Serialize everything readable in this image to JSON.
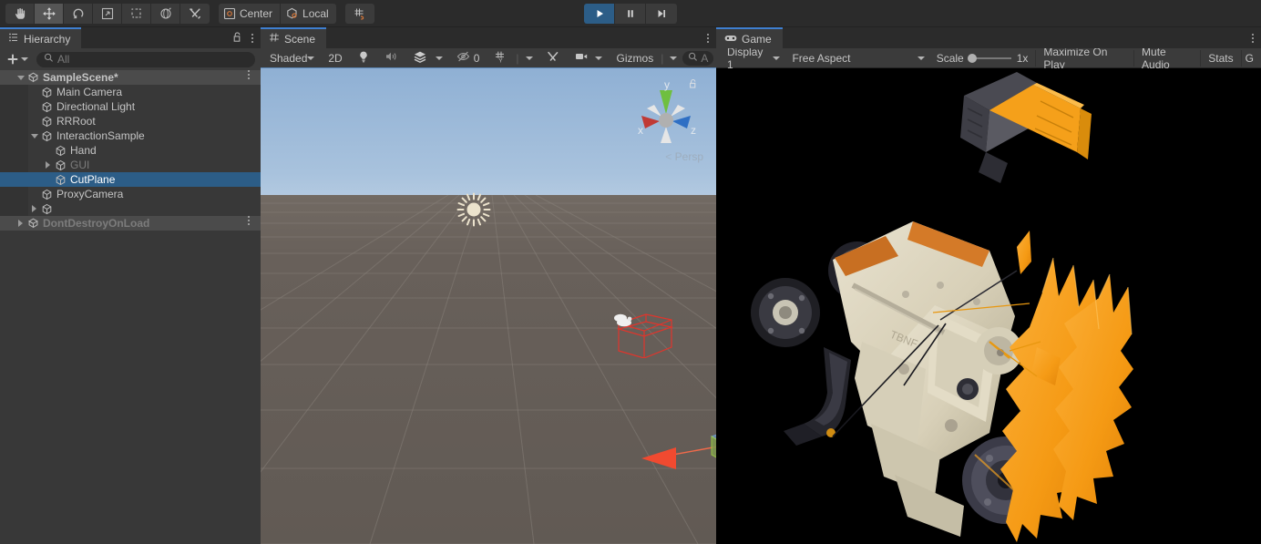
{
  "toolbar": {
    "tools": [
      {
        "name": "hand-tool",
        "icon": "hand-icon",
        "active": false
      },
      {
        "name": "move-tool",
        "icon": "move-icon",
        "active": true
      },
      {
        "name": "rotate-tool",
        "icon": "rotate-icon",
        "active": false
      },
      {
        "name": "scale-tool",
        "icon": "scale-icon",
        "active": false
      },
      {
        "name": "rect-tool",
        "icon": "rect-transform-icon",
        "active": false
      },
      {
        "name": "transform-tool",
        "icon": "transform-icon",
        "active": false
      },
      {
        "name": "custom-editor-tool",
        "icon": "wrench-hammer-icon",
        "active": false
      }
    ],
    "pivot_mode": "Center",
    "pivot_rotation": "Local",
    "snap_tooltip": "grid-snap",
    "play_controls": [
      {
        "name": "play-button",
        "icon": "play-icon",
        "on": true
      },
      {
        "name": "pause-button",
        "icon": "pause-icon",
        "on": false
      },
      {
        "name": "step-button",
        "icon": "step-icon",
        "on": false
      }
    ]
  },
  "hierarchy": {
    "tab_label": "Hierarchy",
    "tab_icon": "hierarchy-icon",
    "lock_icon": "lock-open-icon",
    "menu_icon": "kebab-menu-icon",
    "add_label": "+",
    "search_placeholder": "All",
    "search_value": "",
    "rows": [
      {
        "label": "SampleScene*",
        "indent": 0,
        "icon": "scene-icon",
        "expander": "down",
        "type": "scene",
        "selected": false,
        "dim": false,
        "menu": true
      },
      {
        "label": "Main Camera",
        "indent": 1,
        "icon": "gameobject-icon",
        "expander": "none",
        "type": "object",
        "selected": false,
        "dim": false,
        "menu": false
      },
      {
        "label": "Directional Light",
        "indent": 1,
        "icon": "gameobject-icon",
        "expander": "none",
        "type": "object",
        "selected": false,
        "dim": false,
        "menu": false
      },
      {
        "label": "RRRoot",
        "indent": 1,
        "icon": "gameobject-icon",
        "expander": "none",
        "type": "object",
        "selected": false,
        "dim": false,
        "menu": false
      },
      {
        "label": "InteractionSample",
        "indent": 1,
        "icon": "gameobject-icon",
        "expander": "down",
        "type": "object",
        "selected": false,
        "dim": false,
        "menu": false
      },
      {
        "label": "Hand",
        "indent": 2,
        "icon": "gameobject-icon",
        "expander": "none",
        "type": "object",
        "selected": false,
        "dim": false,
        "menu": false
      },
      {
        "label": "GUI",
        "indent": 2,
        "icon": "gameobject-icon",
        "expander": "right",
        "type": "object",
        "selected": false,
        "dim": true,
        "menu": false
      },
      {
        "label": "CutPlane",
        "indent": 2,
        "icon": "gameobject-icon",
        "expander": "none",
        "type": "object",
        "selected": true,
        "dim": false,
        "menu": false
      },
      {
        "label": "ProxyCamera",
        "indent": 1,
        "icon": "gameobject-icon",
        "expander": "none",
        "type": "object",
        "selected": false,
        "dim": false,
        "menu": false
      },
      {
        "label": "",
        "indent": 1,
        "icon": "gameobject-icon",
        "expander": "right",
        "type": "object",
        "selected": false,
        "dim": false,
        "menu": false
      },
      {
        "label": "DontDestroyOnLoad",
        "indent": 0,
        "icon": "scene-icon",
        "expander": "right",
        "type": "scene",
        "selected": false,
        "dim": true,
        "menu": true
      }
    ]
  },
  "scene": {
    "tab_label": "Scene",
    "tab_icon": "scene-view-icon",
    "menu_icon": "kebab-menu-icon",
    "toolbar": {
      "draw_mode": "Shaded",
      "mode_2d": "2D",
      "lighting_icon": "lightbulb-icon",
      "audio_icon": "speaker-icon",
      "fx_icon": "effects-icon",
      "hidden_count": "0",
      "hidden_icon": "eye-slash-icon",
      "grid_icon": "grid-icon",
      "grid_axis": "Y",
      "tools_icon": "scene-tools-icon",
      "camera_icon": "camera-icon",
      "gizmos_label": "Gizmos",
      "search_placeholder": "A",
      "search_icon": "search-icon"
    },
    "gizmo": {
      "axis_x": "x",
      "axis_y": "y",
      "axis_z": "z",
      "projection": "Persp",
      "lock_icon": "lock-open-icon",
      "color_x": "#c03a35",
      "color_y": "#6fbf3f",
      "color_z": "#2f6fc4"
    },
    "objects": [
      {
        "name": "directional-light-gizmo",
        "icon": "sun-icon"
      },
      {
        "name": "cutplane-wireframe",
        "color": "#e0352c"
      },
      {
        "name": "move-gizmo",
        "colors": {
          "x": "#f04a30",
          "y": "#5ecb2e",
          "z": "#2f7fe0"
        }
      }
    ]
  },
  "game": {
    "tab_label": "Game",
    "tab_icon": "gamepad-icon",
    "menu_icon": "kebab-menu-icon",
    "toolbar": {
      "display": "Display 1",
      "aspect": "Free Aspect",
      "scale_label": "Scale",
      "scale_value": "1x",
      "maximize_on_play": "Maximize On Play",
      "mute_audio": "Mute Audio",
      "stats": "Stats",
      "gizmos": "G"
    },
    "render": {
      "description": "engine-model-cutaway",
      "background": "#000000",
      "body_color": "#ded7c2",
      "cut_color": "#f59a14",
      "metal_color": "#3a3a3e"
    }
  }
}
